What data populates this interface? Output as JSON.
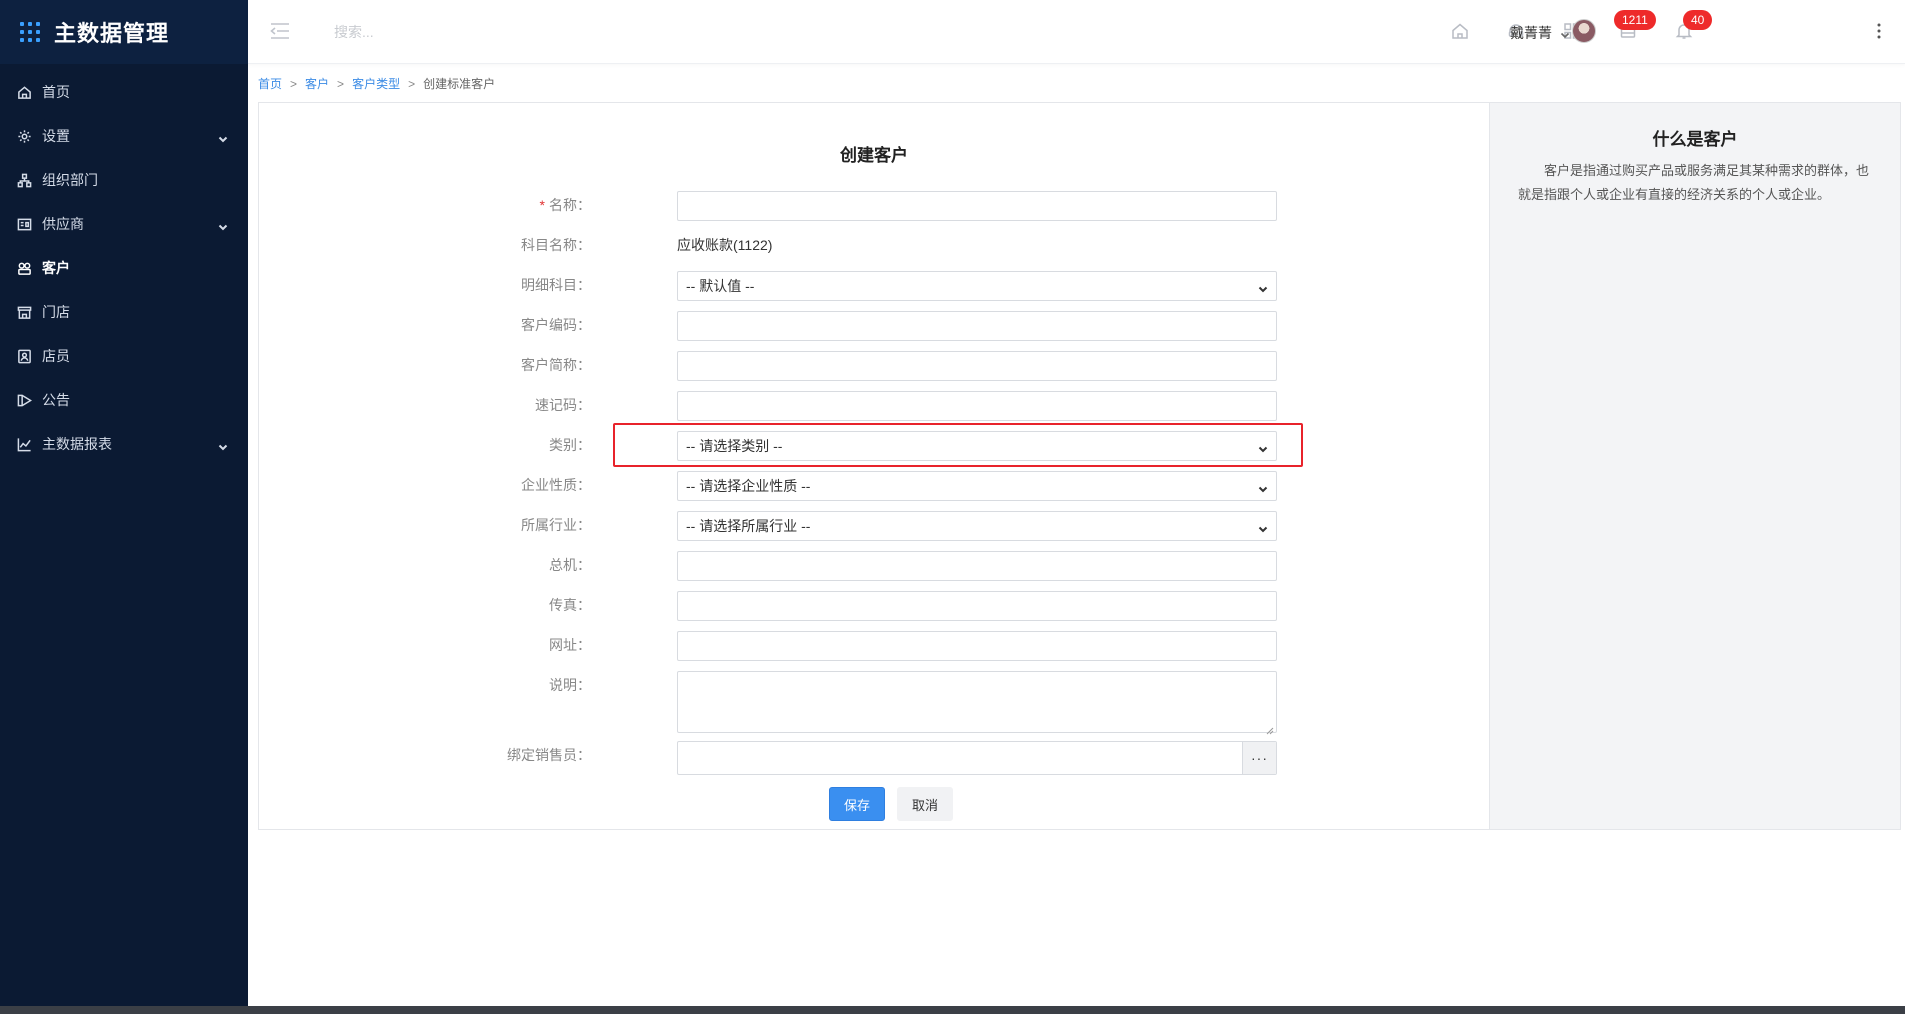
{
  "sidebar": {
    "brand_title": "主数据管理",
    "items": [
      {
        "label": "首页",
        "icon": "home-icon"
      },
      {
        "label": "设置",
        "icon": "gear-icon",
        "has_children": true
      },
      {
        "label": "组织部门",
        "icon": "org-chart-icon"
      },
      {
        "label": "供应商",
        "icon": "supplier-icon",
        "has_children": true
      },
      {
        "label": "客户",
        "icon": "customer-icon",
        "active": true
      },
      {
        "label": "门店",
        "icon": "store-icon"
      },
      {
        "label": "店员",
        "icon": "staff-icon"
      },
      {
        "label": "公告",
        "icon": "announcement-icon"
      },
      {
        "label": "主数据报表",
        "icon": "chart-line-icon",
        "has_children": true
      }
    ]
  },
  "header": {
    "search_placeholder": "搜索...",
    "badge_messages": "1211",
    "badge_notifications": "40",
    "user_name": "戴菁菁"
  },
  "breadcrumb": {
    "home": "首页",
    "customer": "客户",
    "customer_type": "客户类型",
    "current": "创建标准客户",
    "sep": ">"
  },
  "form": {
    "title": "创建客户",
    "name_label": "名称：",
    "required_mark": "*",
    "account_label": "科目名称：",
    "account_value": "应收账款(1122)",
    "detail_account_label": "明细科目：",
    "detail_account_value": "-- 默认值 --",
    "code_label": "客户编码：",
    "short_name_label": "客户简称：",
    "quick_code_label": "速记码：",
    "category_label": "类别：",
    "category_value": "-- 请选择类别 --",
    "enterprise_type_label": "企业性质：",
    "enterprise_type_value": "-- 请选择企业性质 --",
    "industry_label": "所属行业：",
    "industry_value": "-- 请选择所属行业 --",
    "phone_label": "总机：",
    "fax_label": "传真：",
    "website_label": "网址：",
    "description_label": "说明：",
    "salesperson_label": "绑定销售员：",
    "picker_label": "···",
    "save_label": "保存",
    "cancel_label": "取消"
  },
  "info": {
    "title": "什么是客户",
    "text": "客户是指通过购买产品或服务满足其某种需求的群体，也就是指跟个人或企业有直接的经济关系的个人或企业。"
  },
  "colors": {
    "sidebar_bg": "#0b1a33",
    "primary": "#3a8ff0",
    "badge": "#ee2a2a",
    "highlight": "#e8232b"
  }
}
